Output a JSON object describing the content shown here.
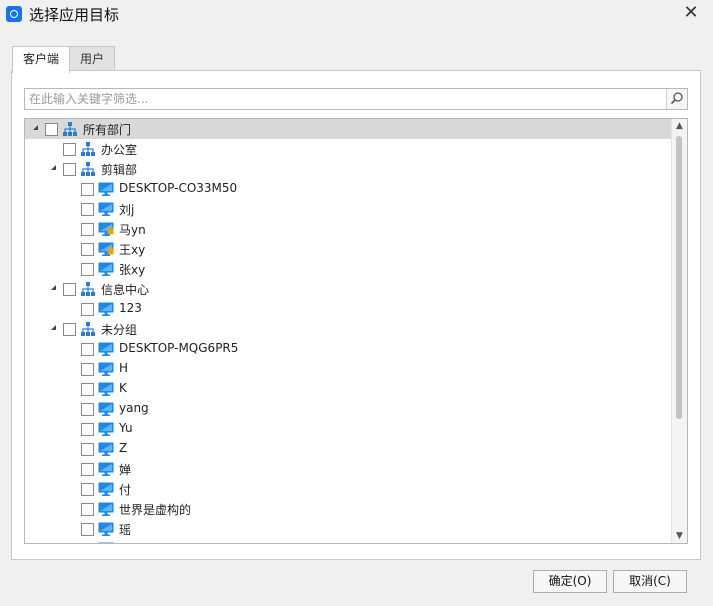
{
  "window": {
    "title": "选择应用目标"
  },
  "tabs": [
    {
      "label": "客户端",
      "active": true
    },
    {
      "label": "用户",
      "active": false
    }
  ],
  "search": {
    "placeholder": "在此输入关键字筛选...",
    "value": ""
  },
  "tree": [
    {
      "label": "所有部门",
      "type": "group",
      "level": 0,
      "expanded": true,
      "selected": true
    },
    {
      "label": "办公室",
      "type": "group",
      "level": 1,
      "expanded": false
    },
    {
      "label": "剪辑部",
      "type": "group",
      "level": 1,
      "expanded": true
    },
    {
      "label": "DESKTOP-CO33M50",
      "type": "computer",
      "level": 2
    },
    {
      "label": "刘j",
      "type": "computer",
      "level": 2
    },
    {
      "label": "马yn",
      "type": "computer-locked",
      "level": 2
    },
    {
      "label": "王xy",
      "type": "computer-locked",
      "level": 2
    },
    {
      "label": "张xy",
      "type": "computer",
      "level": 2
    },
    {
      "label": "信息中心",
      "type": "group",
      "level": 1,
      "expanded": true
    },
    {
      "label": "123",
      "type": "computer",
      "level": 2
    },
    {
      "label": "未分组",
      "type": "group",
      "level": 1,
      "expanded": true
    },
    {
      "label": "DESKTOP-MQG6PR5",
      "type": "computer",
      "level": 2
    },
    {
      "label": "H",
      "type": "computer",
      "level": 2
    },
    {
      "label": "K",
      "type": "computer",
      "level": 2
    },
    {
      "label": "yang",
      "type": "computer",
      "level": 2
    },
    {
      "label": "Yu",
      "type": "computer",
      "level": 2
    },
    {
      "label": "Z",
      "type": "computer",
      "level": 2
    },
    {
      "label": "婵",
      "type": "computer",
      "level": 2
    },
    {
      "label": "付",
      "type": "computer",
      "level": 2
    },
    {
      "label": "世界是虚构的",
      "type": "computer",
      "level": 2
    },
    {
      "label": "瑶",
      "type": "computer",
      "level": 2
    },
    {
      "label": "",
      "type": "computer",
      "level": 2
    }
  ],
  "icons": {
    "app": "app-logo-icon",
    "close": "close-icon",
    "search": "search-icon",
    "group": "org-tree-icon",
    "computer": "monitor-icon",
    "lock": "lock-badge-icon"
  },
  "colors": {
    "accent": "#1a73e8",
    "group": "#2b7cd3",
    "monitor": "#1e88e5",
    "lock": "#e9a400"
  },
  "buttons": {
    "ok": "确定(O)",
    "cancel": "取消(C)"
  }
}
